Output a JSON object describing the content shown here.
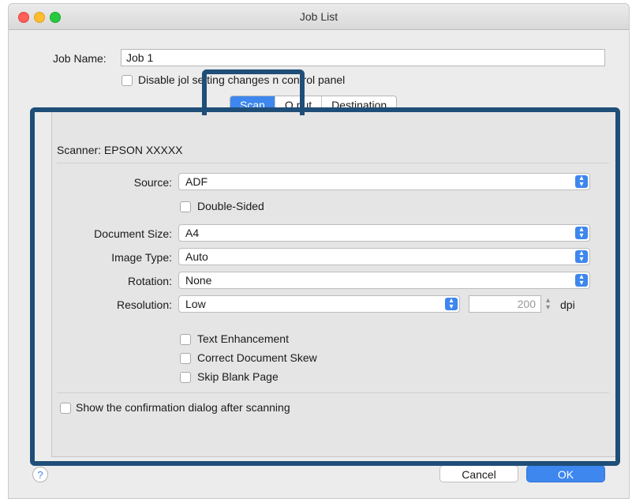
{
  "window": {
    "title": "Job List"
  },
  "job_name": {
    "label": "Job Name:",
    "value": "Job 1"
  },
  "disable_checkbox": {
    "label": "Disable jol  setting changes  n control panel"
  },
  "tabs": [
    {
      "label": "Scan",
      "active": true
    },
    {
      "label": "O  put",
      "active": false
    },
    {
      "label": "Destination",
      "active": false
    }
  ],
  "scanner": {
    "text": "Scanner: EPSON XXXXX"
  },
  "source": {
    "label": "Source:",
    "value": "ADF"
  },
  "double_sided": {
    "label": "Double-Sided"
  },
  "document_size": {
    "label": "Document Size:",
    "value": "A4"
  },
  "image_type": {
    "label": "Image Type:",
    "value": "Auto"
  },
  "rotation": {
    "label": "Rotation:",
    "value": "None"
  },
  "resolution": {
    "label": "Resolution:",
    "value": "Low",
    "dpi_value": "200",
    "dpi_unit": "dpi"
  },
  "options": [
    {
      "label": "Text Enhancement"
    },
    {
      "label": "Correct Document Skew"
    },
    {
      "label": "Skip Blank Page"
    }
  ],
  "confirmation": {
    "label": "Show the confirmation dialog after scanning"
  },
  "buttons": {
    "help": "?",
    "cancel": "Cancel",
    "ok": "OK"
  },
  "colors": {
    "accent": "#3d87ee",
    "highlight_border": "#1f4e78"
  }
}
